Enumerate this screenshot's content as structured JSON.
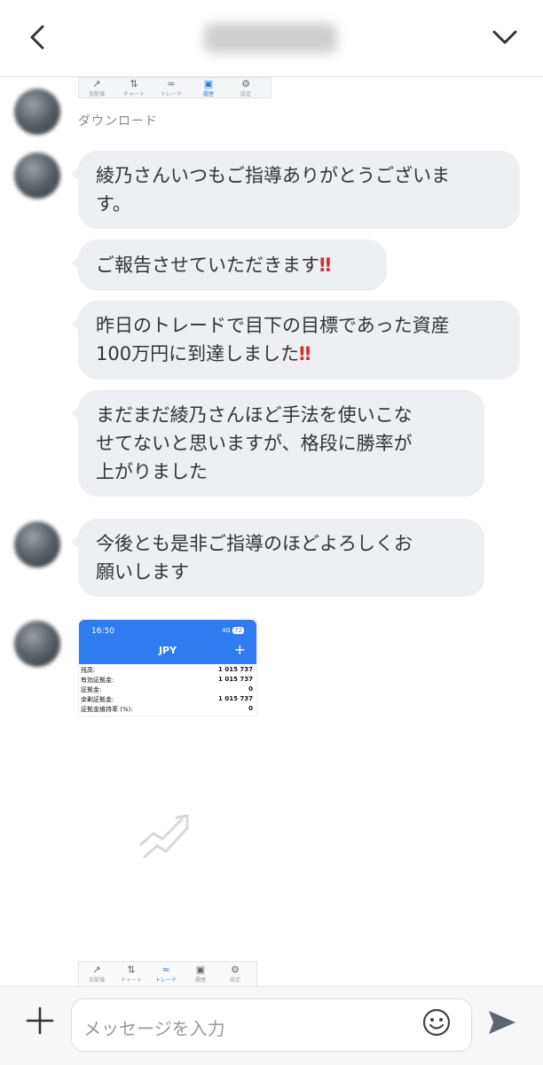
{
  "header": {
    "title": "",
    "back_icon": "chevron-left-icon",
    "menu_icon": "chevron-down-icon"
  },
  "top_strip": {
    "tabs": [
      "気配値",
      "チャート",
      "トレード",
      "履歴",
      "設定"
    ]
  },
  "download_label": "ダウンロード",
  "messages": [
    {
      "lines": [
        "綾乃さんいつもご指導ありがとうございま",
        "す。"
      ]
    },
    {
      "lines": [
        "ご報告させていただきます"
      ],
      "emoji": "‼"
    },
    {
      "lines": [
        "昨日のトレードで目下の目標であった資産",
        "100万円に到達しました"
      ],
      "emoji": "‼"
    },
    {
      "lines": [
        "まだまだ綾乃さんほど手法を使いこな",
        "せてないと思いますが、格段に勝率が",
        "上がりました"
      ]
    },
    {
      "lines": [
        "今後とも是非ご指導のほどよろしくお",
        "願いします"
      ]
    }
  ],
  "screenshot": {
    "time": "16:50",
    "status": "4G",
    "battery": "72",
    "currency": "JPY",
    "rows": [
      {
        "label": "残高:",
        "value": "1 015 737"
      },
      {
        "label": "有効証拠金:",
        "value": "1 015 737"
      },
      {
        "label": "証拠金:",
        "value": "0"
      },
      {
        "label": "余剰証拠金:",
        "value": "1 015 737"
      },
      {
        "label": "証拠金維持率 (%):",
        "value": "0"
      }
    ]
  },
  "bottom_strip": {
    "tabs": [
      "気配値",
      "チャート",
      "トレード",
      "履歴",
      "設定"
    ]
  },
  "input": {
    "placeholder": "メッセージを入力"
  },
  "colors": {
    "bubble": "#eeeff2",
    "accent_blue": "#2f7bf0",
    "emphasis_red": "#d22d2d"
  }
}
